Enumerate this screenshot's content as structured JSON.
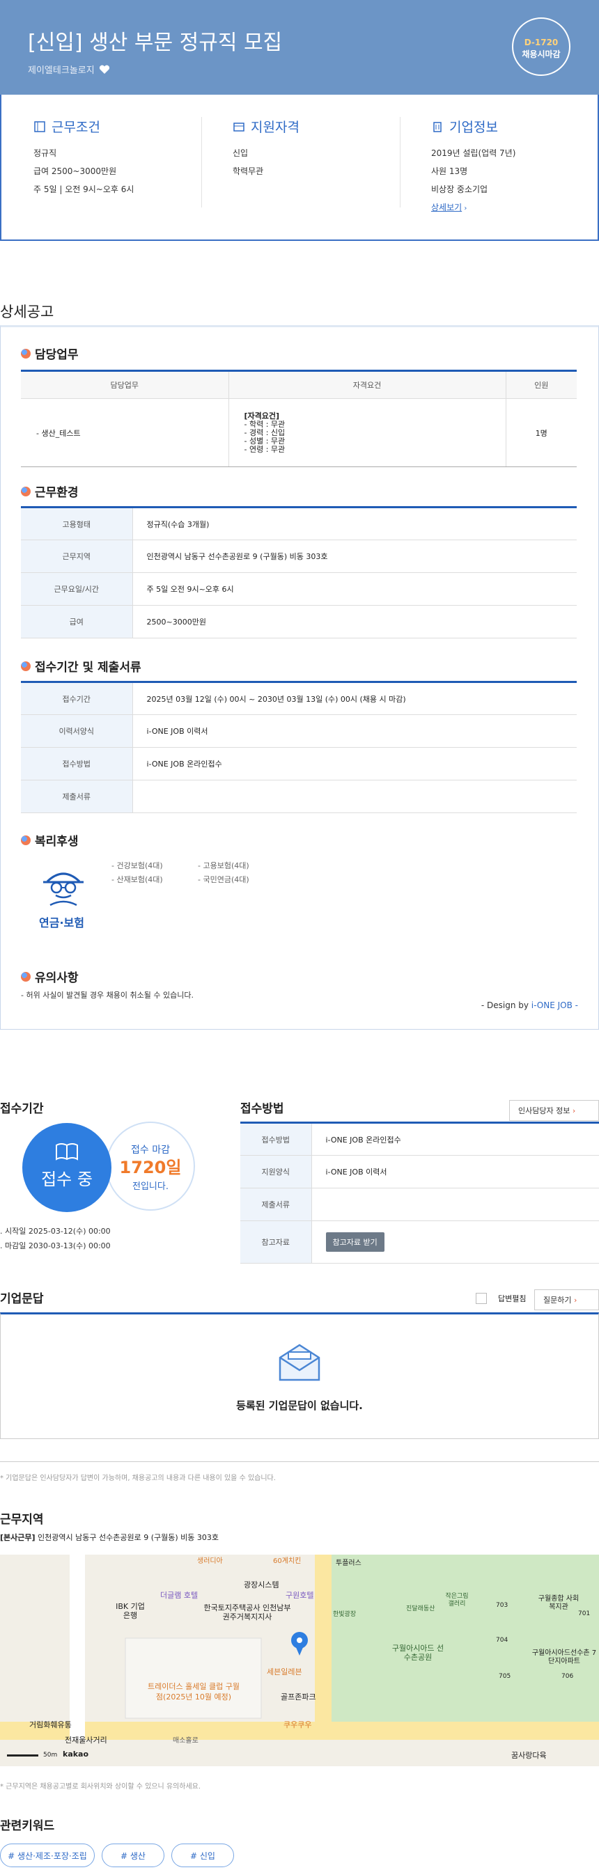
{
  "header": {
    "title": "[신입] 생산 부문 정규직 모집",
    "company": "제이엘테크놀로지",
    "dday": "D-1720",
    "dday_label": "채용시마감"
  },
  "summary": {
    "conditions": {
      "title": "근무조건",
      "lines": [
        "정규직",
        "급여 2500~3000만원",
        "주 5일 | 오전 9시~오후 6시"
      ]
    },
    "qualification": {
      "title": "지원자격",
      "lines": [
        "신입",
        "학력무관"
      ]
    },
    "company": {
      "title": "기업정보",
      "lines": [
        "2019년 설립(업력 7년)",
        "사원 13명",
        "비상장 중소기업"
      ],
      "more": "상세보기"
    }
  },
  "detail": {
    "section_title": "상세공고",
    "duty": {
      "title": "담당업무",
      "headers": [
        "담당업무",
        "자격요건",
        "인원"
      ],
      "task": "- 생산_테스트",
      "req_title": "[자격요건]",
      "req": [
        "- 학력 : 무관",
        "- 경력 : 신입",
        "- 성별 : 무관",
        "- 연령 : 무관"
      ],
      "count": "1명"
    },
    "env": {
      "title": "근무환경",
      "rows": [
        {
          "k": "고용형태",
          "v": "정규직(수습 3개월)"
        },
        {
          "k": "근무지역",
          "v": "인천광역시 남동구 선수촌공원로 9 (구월동) 비동 303호"
        },
        {
          "k": "근무요일/시간",
          "v": "주 5일 오전 9시~오후 6시"
        },
        {
          "k": "급여",
          "v": "2500~3000만원"
        }
      ]
    },
    "apply": {
      "title": "접수기간 및 제출서류",
      "rows": [
        {
          "k": "접수기간",
          "v": "2025년 03월 12일 (수) 00시 ~ 2030년 03월 13일 (수) 00시 (채용 시 마감)"
        },
        {
          "k": "이력서양식",
          "v": "i-ONE JOB 이력서"
        },
        {
          "k": "접수방법",
          "v": "i-ONE JOB 온라인접수"
        },
        {
          "k": "제출서류",
          "v": ""
        }
      ]
    },
    "benefit": {
      "title": "복리후생",
      "label": "연금·보험",
      "items": [
        "- 건강보험(4대)",
        "- 고용보험(4대)",
        "- 산재보험(4대)",
        "- 국민연금(4대)"
      ]
    },
    "notice": {
      "title": "유의사항",
      "text": "- 허위 사실이 발견될 경우 채용이 취소될 수 있습니다."
    },
    "design_prefix": "- Design by ",
    "design_brand": "i-ONE JOB",
    "design_suffix": " -"
  },
  "period": {
    "title": "접수기간",
    "status": "접수 중",
    "deadline_label": "접수 마감",
    "days": "1720일",
    "days_suffix": "전입니다.",
    "start": "시작일 2025-03-12(수) 00:00",
    "end": "마감일 2030-03-13(수) 00:00"
  },
  "method": {
    "title": "접수방법",
    "contact_btn": "인사담당자 정보",
    "rows": [
      {
        "k": "접수방법",
        "v": "i-ONE JOB 온라인접수"
      },
      {
        "k": "지원양식",
        "v": "i-ONE JOB 이력서"
      },
      {
        "k": "제출서류",
        "v": ""
      },
      {
        "k": "참고자료",
        "v": ""
      }
    ],
    "ref_btn": "참고자료 받기"
  },
  "qa": {
    "title": "기업문답",
    "checkbox_label": "답변펼침",
    "ask_btn": "질문하기",
    "empty": "등록된 기업문답이 없습니다.",
    "note": "* 기업문답은 인사담당자가 답변이 가능하며, 채용공고의 내용과 다른 내용이 있을 수 있습니다."
  },
  "location": {
    "title": "근무지역",
    "addr_label": "[본사근무]",
    "addr": "인천광역시 남동구 선수촌공원로 9 (구월동) 비동 303호",
    "note": "* 근무지역은 채용공고별로 회사위치와 상이할 수 있으니 유의하세요.",
    "map_labels": [
      "생러디아",
      "60계치킨",
      "투플러스",
      "더글램 호텔",
      "광장시스템",
      "구원호텔",
      "IBK 기업은행",
      "한국토지주택공사 인천남부권주거복지지사",
      "트레이더스 홀세일 클럽 구월점(2025년 10월 예정)",
      "세븐일레븐",
      "골프존파크",
      "쿠우쿠우",
      "거림화훼유통",
      "전재울사거리",
      "매소홀로",
      "꿈사랑다육",
      "구월아시아드 선수촌공원",
      "한빛광장",
      "진달래동산",
      "작은그림 갤러리",
      "구월종합 사회복지관",
      "구월아시아드선수촌 7단지아파트",
      "703",
      "704",
      "705",
      "706",
      "701",
      "50m",
      "kakao"
    ]
  },
  "keywords": {
    "title": "관련키워드",
    "items": [
      "# 생산·제조·포장·조립",
      "# 생산",
      "# 신입"
    ]
  }
}
